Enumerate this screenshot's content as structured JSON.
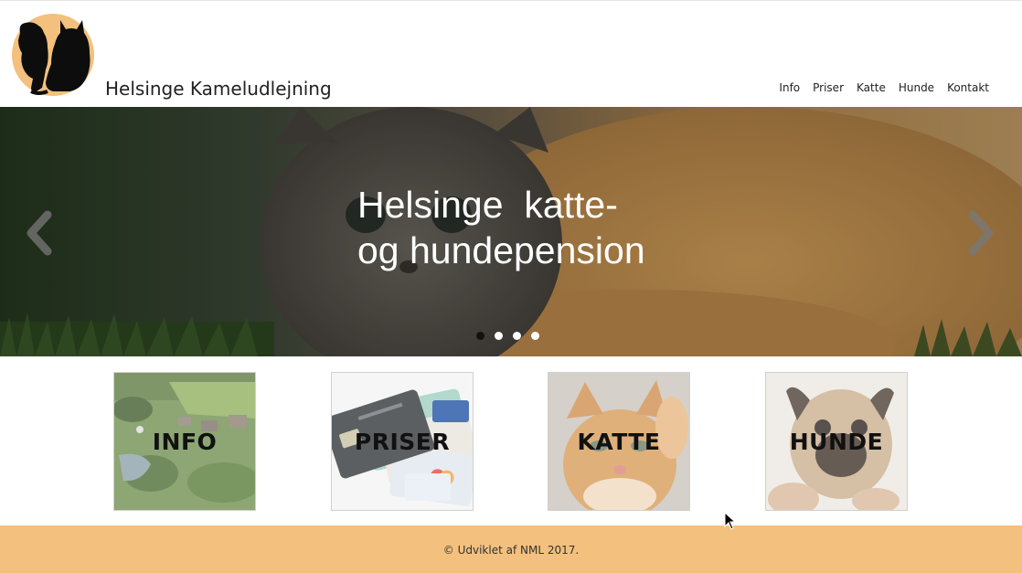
{
  "header": {
    "site_title": "Helsinge Kameludlejning",
    "logo_icon": "cat-and-dog-silhouette-icon",
    "logo_color": "#f3c07d"
  },
  "nav": {
    "items": [
      {
        "label": "Info"
      },
      {
        "label": "Priser"
      },
      {
        "label": "Katte"
      },
      {
        "label": "Hunde"
      },
      {
        "label": "Kontakt"
      }
    ]
  },
  "hero": {
    "title_line1": "Helsinge  katte-",
    "title_line2": "og hundepension",
    "prev_icon": "chevron-left-icon",
    "next_icon": "chevron-right-icon",
    "slides_count": 4,
    "active_slide": 1
  },
  "tiles": [
    {
      "label": "INFO",
      "image": "aerial-village-photo"
    },
    {
      "label": "PRISER",
      "image": "credit-cards-photo"
    },
    {
      "label": "KATTE",
      "image": "ginger-kitten-photo"
    },
    {
      "label": "HUNDE",
      "image": "pug-puppy-photo"
    }
  ],
  "footer": {
    "text": "© Udviklet af NML 2017.",
    "color": "#f3c07d"
  }
}
